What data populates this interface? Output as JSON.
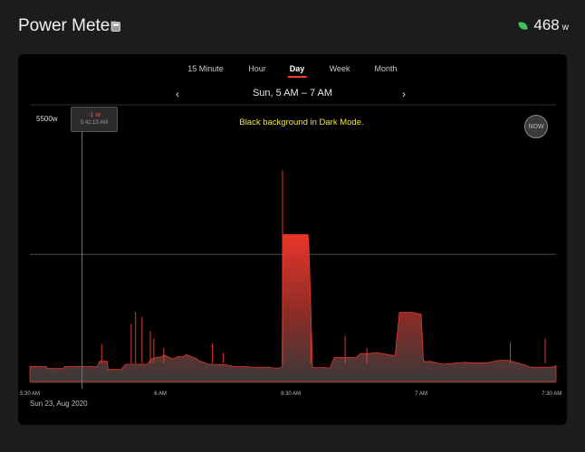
{
  "header": {
    "title": "Power Meter",
    "watts": "468",
    "watts_unit": "w"
  },
  "tabs": [
    {
      "label": "15 Minute",
      "active": false
    },
    {
      "label": "Hour",
      "active": false
    },
    {
      "label": "Day",
      "active": true
    },
    {
      "label": "Week",
      "active": false
    },
    {
      "label": "Month",
      "active": false
    }
  ],
  "range": {
    "label": "Sun, 5 AM – 7 AM",
    "prev": "‹",
    "next": "›"
  },
  "banner": "Black background in Dark Mode.",
  "now_label": "NOW",
  "tooltip": {
    "value": "-1 w",
    "time": "5:42:13 AM"
  },
  "date": "Sun 23, Aug 2020",
  "colors": {
    "accent": "#ff3b30",
    "leaf": "#3cc35a",
    "banner": "#f4e63d"
  },
  "chart_data": {
    "type": "area",
    "ylabel": "5500w",
    "ylim": [
      0,
      5500
    ],
    "x_tick_labels": [
      "5:30 AM",
      "6 AM",
      "6:30 AM",
      "7 AM",
      "7:30 AM"
    ],
    "x_ticks_minutes": [
      330,
      360,
      390,
      420,
      450
    ],
    "xlim_minutes": [
      330,
      451
    ],
    "reference_line_w": 2650,
    "cursor_minute": 342,
    "series": [
      {
        "x": [
          330,
          333.8,
          334,
          337.7,
          338,
          345.5,
          346,
          347.8,
          348,
          351,
          352,
          357,
          357.6,
          358,
          359,
          360,
          361,
          362,
          363,
          364,
          365,
          366,
          367,
          368,
          369,
          370,
          371,
          375,
          376,
          377,
          380,
          381,
          385,
          386,
          387,
          388,
          388.2,
          388.8,
          394,
          394.2,
          395,
          395.5,
          398,
          399,
          400,
          405,
          406,
          408,
          409,
          410,
          413,
          414,
          415,
          416,
          417,
          418,
          419,
          420,
          420.5,
          421,
          422,
          425,
          430,
          431,
          435,
          438,
          440,
          444,
          445,
          450,
          451
        ],
        "y": [
          310,
          310,
          270,
          270,
          310,
          310,
          420,
          420,
          250,
          250,
          360,
          360,
          430,
          470,
          500,
          510,
          550,
          500,
          470,
          520,
          510,
          560,
          520,
          490,
          430,
          400,
          360,
          350,
          330,
          310,
          310,
          300,
          300,
          280,
          280,
          300,
          3060,
          3060,
          3060,
          2750,
          300,
          290,
          290,
          280,
          500,
          500,
          580,
          580,
          600,
          600,
          550,
          540,
          1440,
          1440,
          1440,
          1440,
          1420,
          1400,
          440,
          410,
          420,
          360,
          400,
          390,
          390,
          440,
          440,
          340,
          300,
          300,
          330
        ]
      }
    ],
    "spikes": [
      {
        "x": 346.5,
        "y": 780
      },
      {
        "x": 353.3,
        "y": 1200
      },
      {
        "x": 354.3,
        "y": 1450
      },
      {
        "x": 355.8,
        "y": 1350
      },
      {
        "x": 357.7,
        "y": 1050
      },
      {
        "x": 358.5,
        "y": 900
      },
      {
        "x": 360.8,
        "y": 700
      },
      {
        "x": 372,
        "y": 800
      },
      {
        "x": 374.5,
        "y": 600
      },
      {
        "x": 388.1,
        "y": 4400
      },
      {
        "x": 394.6,
        "y": 1000
      },
      {
        "x": 402.5,
        "y": 950
      },
      {
        "x": 407.5,
        "y": 700
      },
      {
        "x": 440.5,
        "y": 820
      },
      {
        "x": 448.5,
        "y": 900
      }
    ]
  }
}
